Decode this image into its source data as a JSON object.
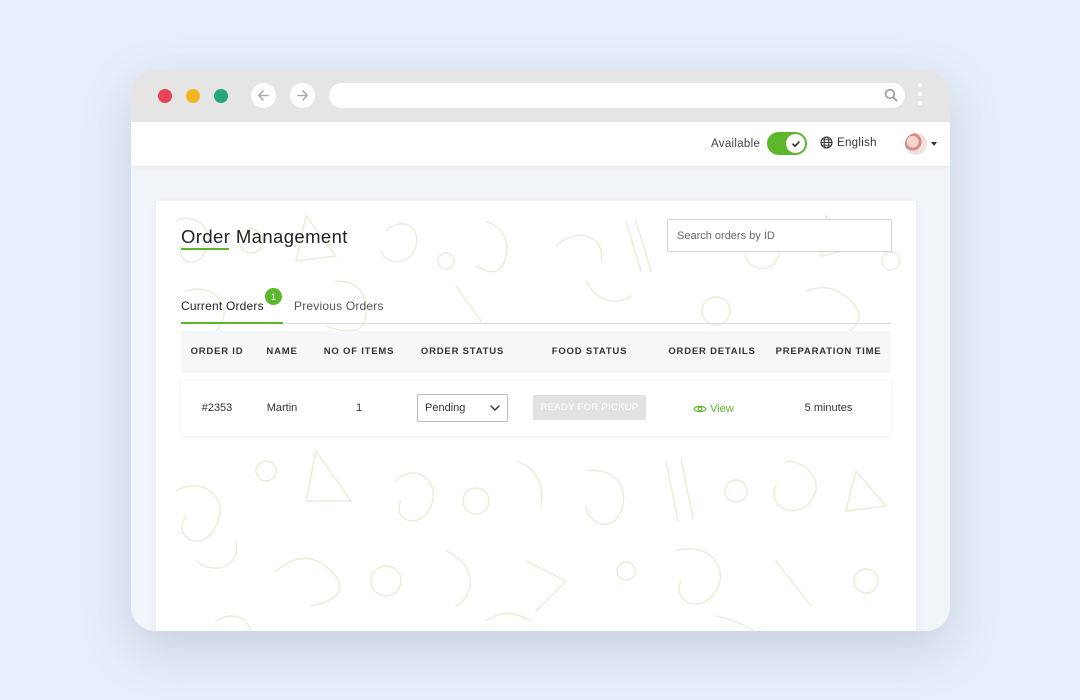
{
  "browser": {
    "url": "",
    "colors": {
      "close": "#e94155",
      "minimize": "#f3b522",
      "maximize": "#26a57e"
    }
  },
  "topbar": {
    "available_label": "Available",
    "available_on": true,
    "language": "English"
  },
  "page": {
    "title": "Order Management",
    "search_placeholder": "Search orders by ID",
    "accent_color": "#5cb82a"
  },
  "tabs": [
    {
      "label": "Current Orders",
      "badge": "1",
      "active": true
    },
    {
      "label": "Previous Orders",
      "active": false
    }
  ],
  "table": {
    "columns": [
      "ORDER ID",
      "NAME",
      "NO OF ITEMS",
      "ORDER STATUS",
      "FOOD STATUS",
      "ORDER DETAILS",
      "PREPARATION TIME"
    ],
    "rows": [
      {
        "order_id": "#2353",
        "name": "Martin",
        "items": "1",
        "order_status": "Pending",
        "food_status": "READY FOR PICKUP",
        "details": "View",
        "prep_time": "5 minutes"
      }
    ]
  }
}
